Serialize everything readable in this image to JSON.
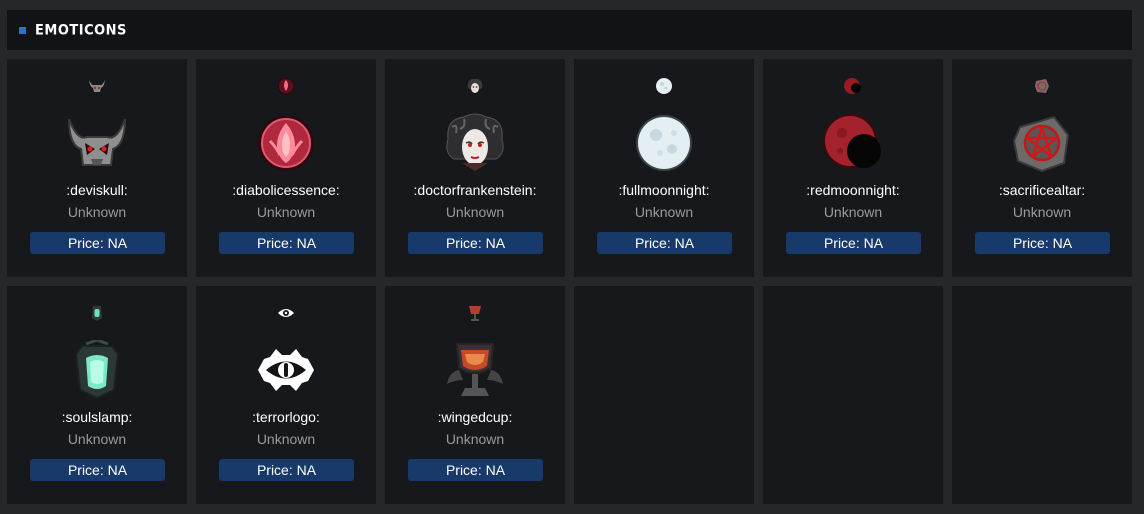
{
  "section": {
    "title": "EMOTICONS"
  },
  "price_label": "Price: NA",
  "emoticons": [
    {
      "name": ":deviskull:",
      "rarity": "Unknown",
      "price": "Price: NA",
      "icon": "devil-skull-icon"
    },
    {
      "name": ":diabolicessence:",
      "rarity": "Unknown",
      "price": "Price: NA",
      "icon": "diabolic-essence-icon"
    },
    {
      "name": ":doctorfrankenstein:",
      "rarity": "Unknown",
      "price": "Price: NA",
      "icon": "doctor-frankenstein-icon"
    },
    {
      "name": ":fullmoonnight:",
      "rarity": "Unknown",
      "price": "Price: NA",
      "icon": "full-moon-icon"
    },
    {
      "name": ":redmoonnight:",
      "rarity": "Unknown",
      "price": "Price: NA",
      "icon": "red-moon-icon"
    },
    {
      "name": ":sacrificealtar:",
      "rarity": "Unknown",
      "price": "Price: NA",
      "icon": "sacrifice-altar-icon"
    },
    {
      "name": ":soulslamp:",
      "rarity": "Unknown",
      "price": "Price: NA",
      "icon": "souls-lamp-icon"
    },
    {
      "name": ":terrorlogo:",
      "rarity": "Unknown",
      "price": "Price: NA",
      "icon": "terror-eye-icon"
    },
    {
      "name": ":wingedcup:",
      "rarity": "Unknown",
      "price": "Price: NA",
      "icon": "winged-cup-icon"
    }
  ],
  "colors": {
    "background": "#25272b",
    "card": "#17181b",
    "header": "#121316",
    "accent": "#2f6fd0",
    "price_button": "#173a6b"
  }
}
